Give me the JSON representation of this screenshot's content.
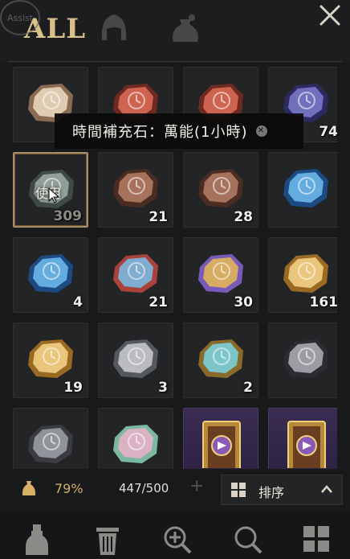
{
  "tabs": {
    "all_label": "ALL",
    "assist_label": "Assist"
  },
  "tooltip": {
    "text": "時間補充石：萬能(1小時)"
  },
  "items": [
    {
      "gem": "cream",
      "qty": ""
    },
    {
      "gem": "red",
      "qty": ""
    },
    {
      "gem": "red",
      "qty": ""
    },
    {
      "gem": "purple",
      "qty": "74"
    },
    {
      "gem": "grey",
      "qty": "309",
      "faded": true,
      "selected": true,
      "use_label": "使用"
    },
    {
      "gem": "brown",
      "qty": "21"
    },
    {
      "gem": "brown",
      "qty": "28"
    },
    {
      "gem": "blue",
      "qty": ""
    },
    {
      "gem": "blue",
      "qty": "4"
    },
    {
      "gem": "blue-red",
      "qty": "21"
    },
    {
      "gem": "rainbow",
      "qty": "30"
    },
    {
      "gem": "gold",
      "qty": "161"
    },
    {
      "gem": "gold",
      "qty": "19"
    },
    {
      "gem": "silver",
      "qty": "3"
    },
    {
      "gem": "teal-ornate",
      "qty": "2"
    },
    {
      "gem": "yinyang",
      "qty": ""
    },
    {
      "gem": "yinyang-grey",
      "qty": ""
    },
    {
      "gem": "rainbow-pastel",
      "qty": ""
    },
    {
      "gem": "card",
      "qty": ""
    },
    {
      "gem": "card",
      "qty": ""
    }
  ],
  "status": {
    "weight_percent": "79%",
    "capacity": "447/500",
    "sort_label": "排序"
  },
  "colors": {
    "accent_gold": "#d9c089",
    "weight": "#d6b064",
    "selected_border": "#a88c64"
  }
}
